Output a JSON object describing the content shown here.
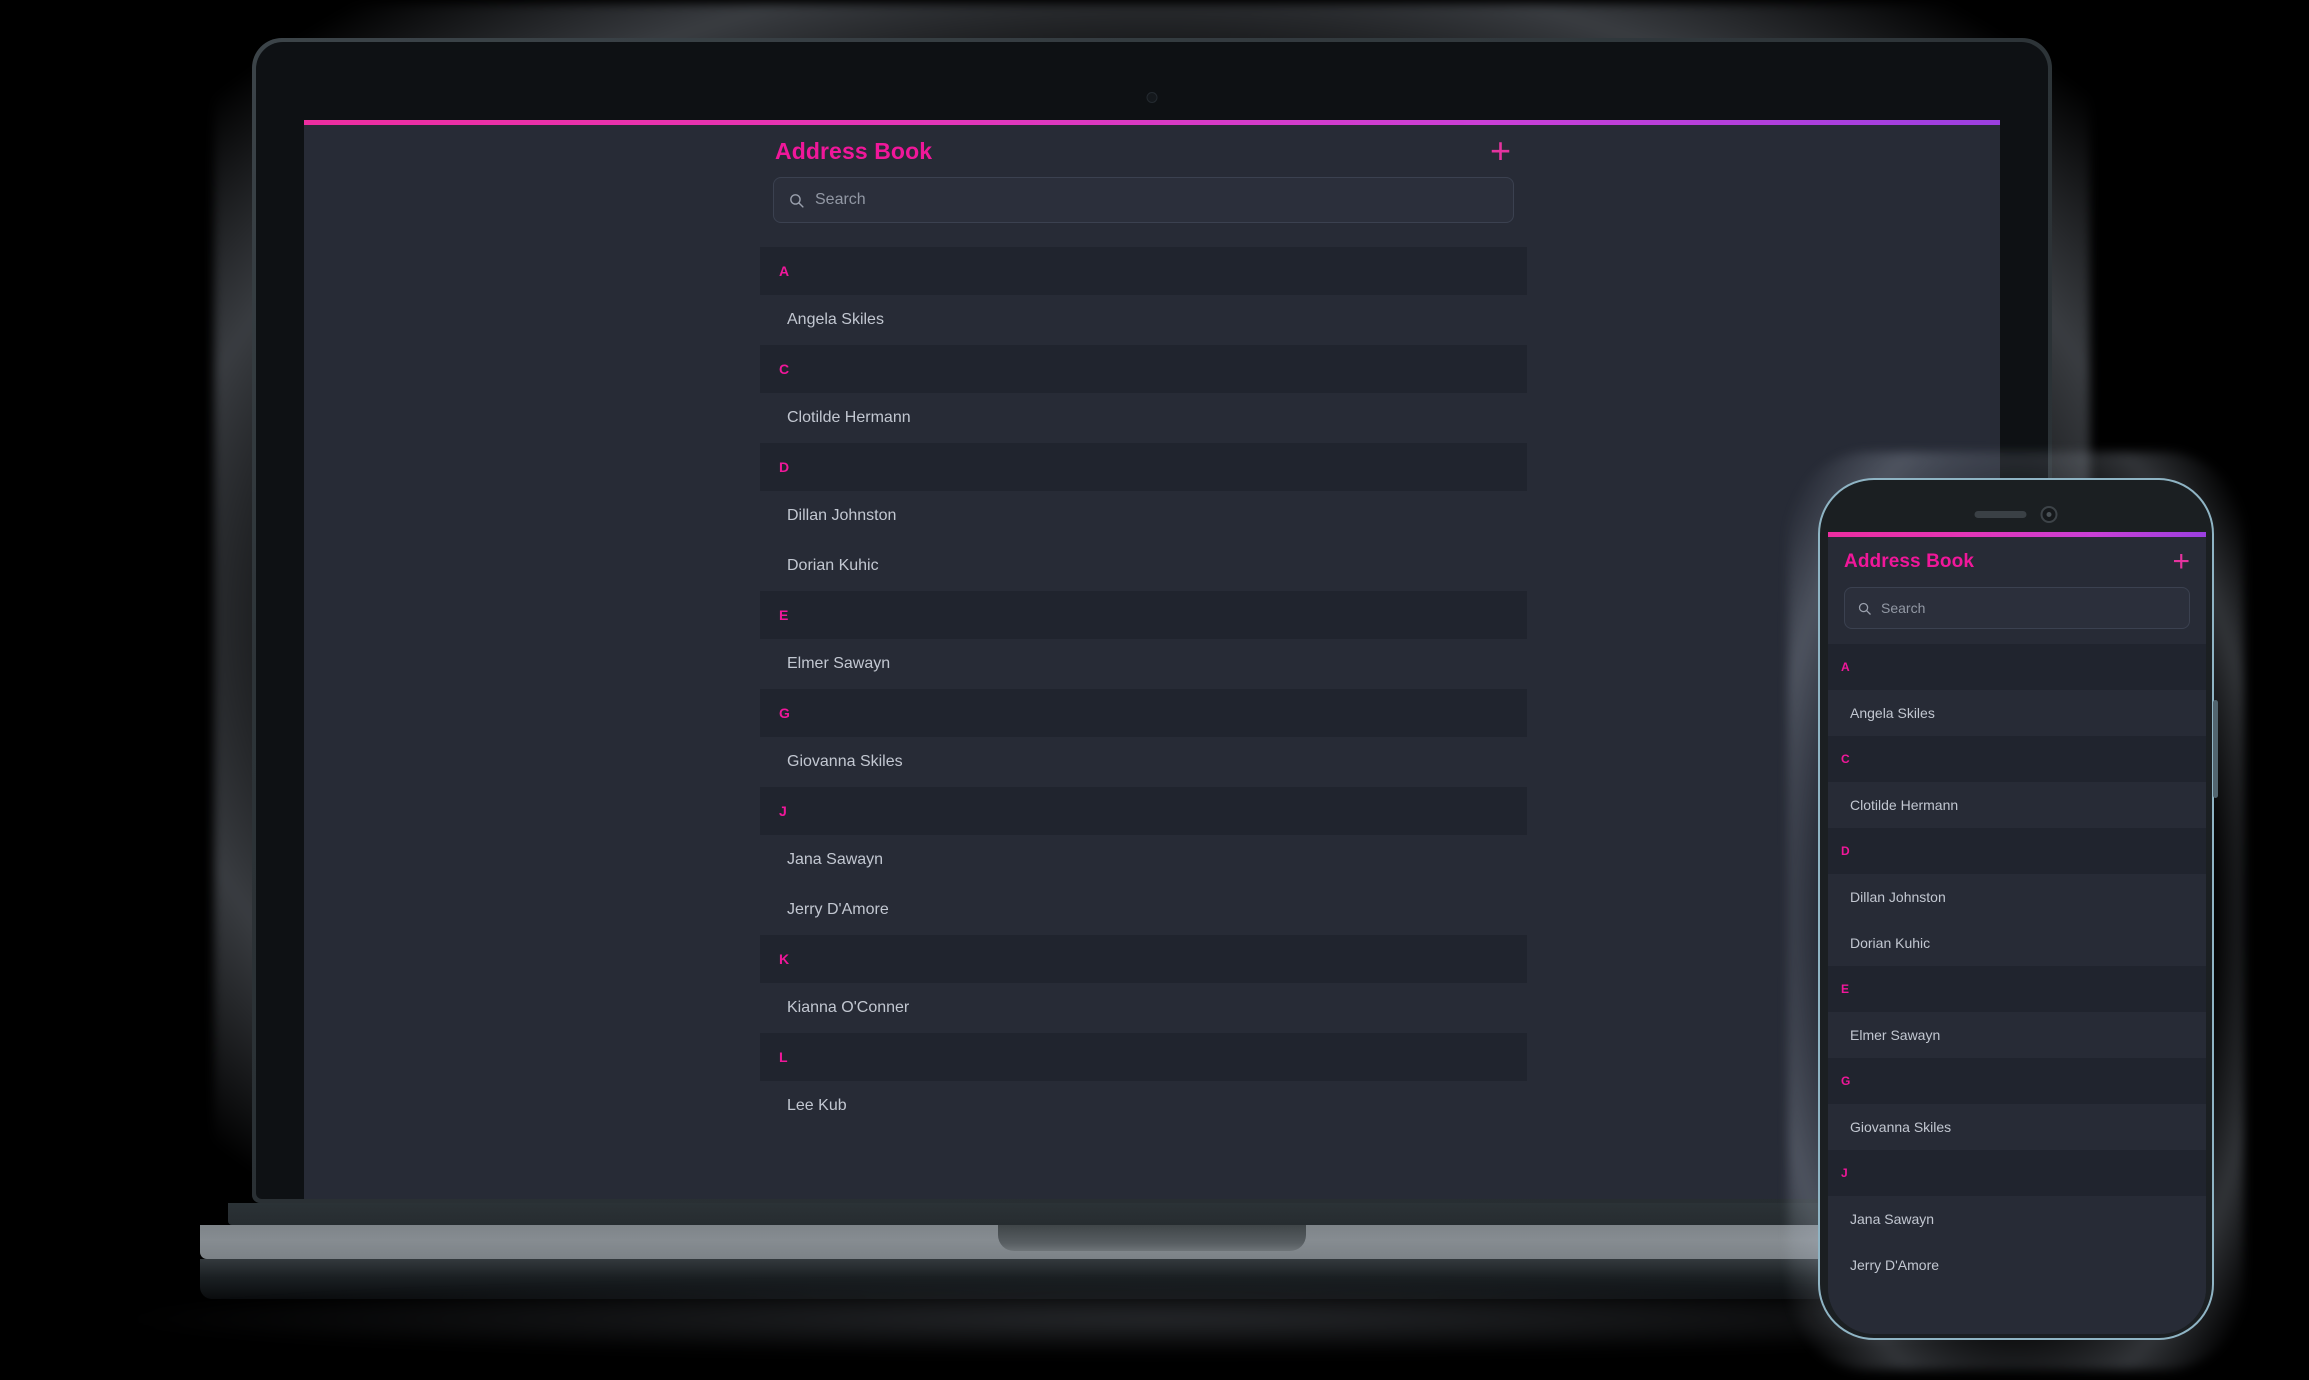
{
  "app": {
    "title": "Address Book",
    "add_button_label": "+",
    "search": {
      "placeholder": "Search",
      "value": "",
      "icon": "search-icon"
    },
    "accent_color": "#f0179a",
    "accent_gradient_start": "#ec2da0",
    "accent_gradient_end": "#9b3fe0",
    "background_color": "#272b36",
    "section_header_background": "#20242e",
    "contact_text_color": "#c2c7d1"
  },
  "laptop": {
    "camera_icon": "camera-dot-icon",
    "sections": [
      {
        "letter": "A",
        "contacts": [
          "Angela Skiles"
        ]
      },
      {
        "letter": "C",
        "contacts": [
          "Clotilde Hermann"
        ]
      },
      {
        "letter": "D",
        "contacts": [
          "Dillan Johnston",
          "Dorian Kuhic"
        ]
      },
      {
        "letter": "E",
        "contacts": [
          "Elmer Sawayn"
        ]
      },
      {
        "letter": "G",
        "contacts": [
          "Giovanna Skiles"
        ]
      },
      {
        "letter": "J",
        "contacts": [
          "Jana Sawayn",
          "Jerry D'Amore"
        ]
      },
      {
        "letter": "K",
        "contacts": [
          "Kianna O'Conner"
        ]
      },
      {
        "letter": "L",
        "contacts": [
          "Lee Kub"
        ]
      }
    ]
  },
  "phone": {
    "speaker_icon": "speaker-grille-icon",
    "camera_icon": "front-camera-icon",
    "side_button": "power-button",
    "sections": [
      {
        "letter": "A",
        "contacts": [
          "Angela Skiles"
        ]
      },
      {
        "letter": "C",
        "contacts": [
          "Clotilde Hermann"
        ]
      },
      {
        "letter": "D",
        "contacts": [
          "Dillan Johnston",
          "Dorian Kuhic"
        ]
      },
      {
        "letter": "E",
        "contacts": [
          "Elmer Sawayn"
        ]
      },
      {
        "letter": "G",
        "contacts": [
          "Giovanna Skiles"
        ]
      },
      {
        "letter": "J",
        "contacts": [
          "Jana Sawayn",
          "Jerry D'Amore"
        ]
      }
    ]
  }
}
